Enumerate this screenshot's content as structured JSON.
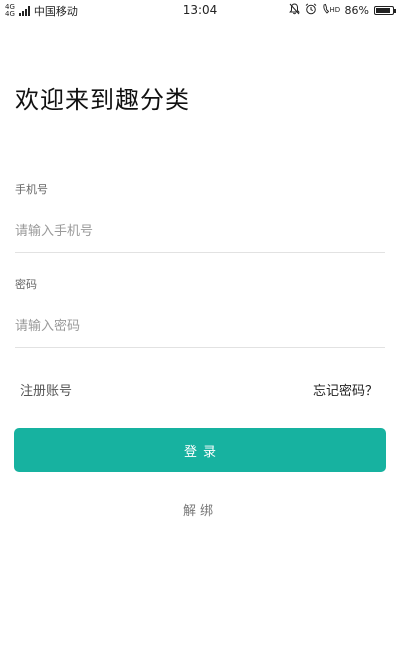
{
  "status_bar": {
    "network_top": "4G",
    "network_bottom": "4G",
    "carrier": "中国移动",
    "time": "13:04",
    "battery": "86%",
    "battery_level": 0.86,
    "icons": [
      "bell-muted-icon",
      "alarm-icon",
      "volte-hd-icon",
      "battery-icon"
    ]
  },
  "login": {
    "welcome_title": "欢迎来到趣分类",
    "phone_label": "手机号",
    "phone_placeholder": "请输入手机号",
    "phone_value": "",
    "password_label": "密码",
    "password_placeholder": "请输入密码",
    "password_value": "",
    "register_link": "注册账号",
    "forgot_link": "忘记密码？",
    "login_button": "登录",
    "unbind_link": "解绑"
  },
  "colors": {
    "accent": "#17b2a0",
    "background": "#ffffff"
  }
}
